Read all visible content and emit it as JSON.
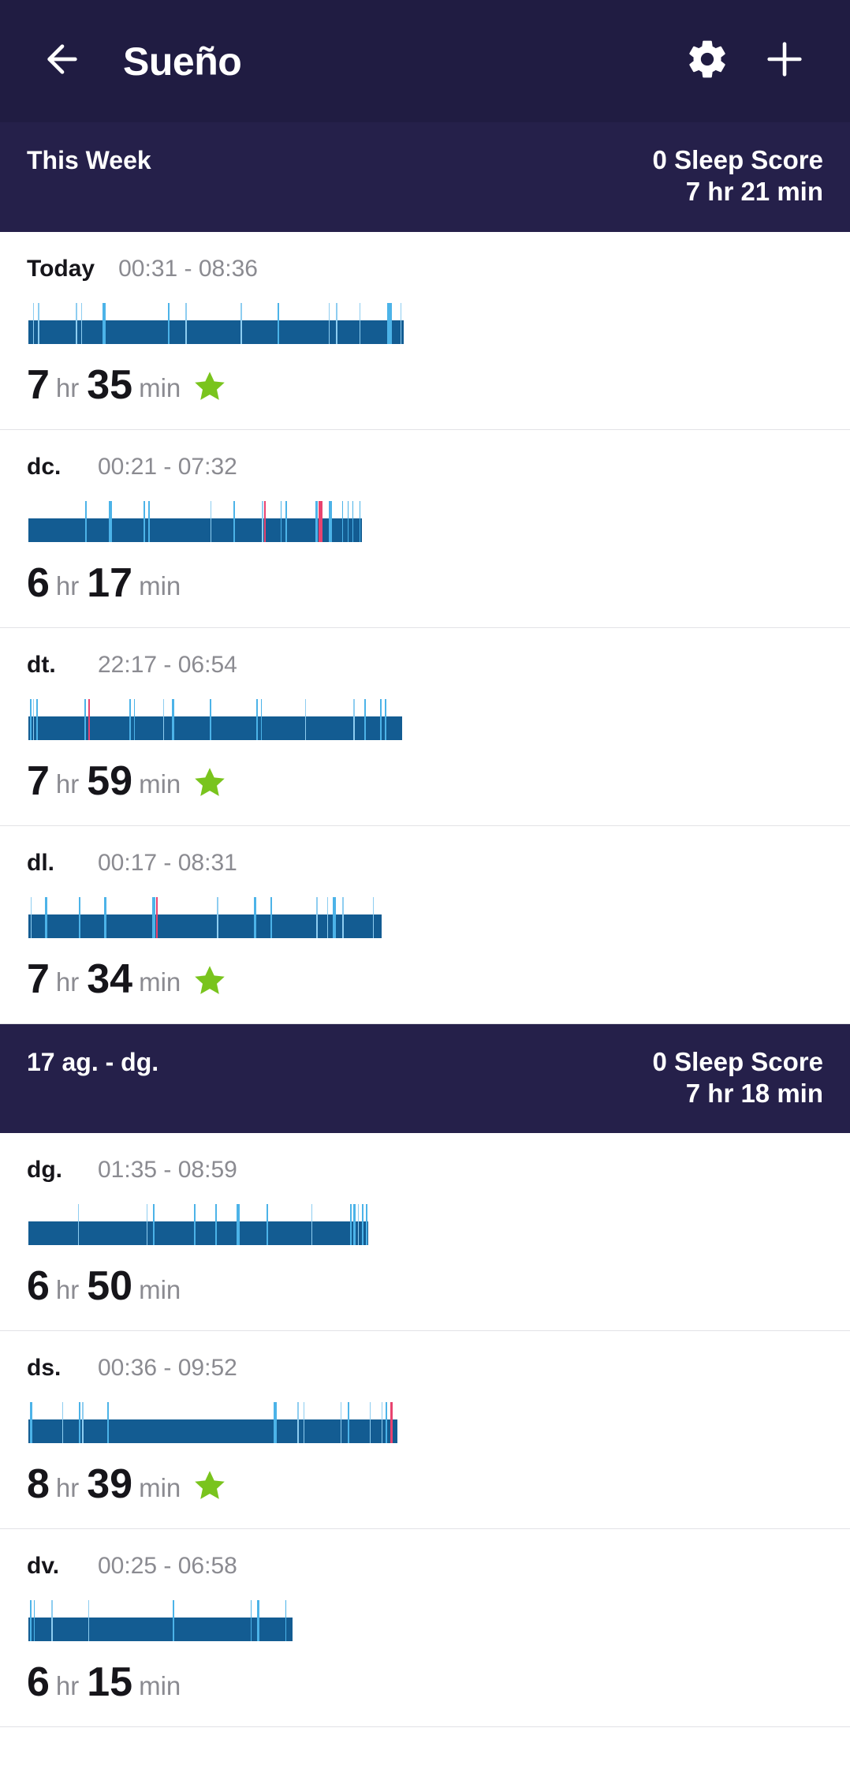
{
  "appbar": {
    "title": "Sueño",
    "back_icon": "arrow-left-icon",
    "settings_icon": "gear-icon",
    "add_icon": "plus-icon"
  },
  "colors": {
    "header_bg": "#201c42",
    "band_bg": "#25204a",
    "sleep_deep": "#135c92",
    "sleep_awake": "#4cb3e8",
    "sleep_awake_light": "#8ecdf0",
    "sleep_alert": "#e8436f",
    "star_green": "#79c41d",
    "page_bg": "#ffffff",
    "muted_text": "#8b8b91",
    "primary_text": "#16151a"
  },
  "sections": [
    {
      "label": "This Week",
      "score": "0 Sleep Score",
      "total": "7 hr 21 min",
      "entries": [
        {
          "day": "Today",
          "times": "00:31 - 08:36",
          "dur_hours": "7",
          "hr_label": "hr",
          "dur_minutes": "35",
          "min_label": "min",
          "starred": true,
          "bar_width_pct": 47.2,
          "ticks": [
            {
              "pos": 1.2,
              "w": 0.35,
              "c": "#8ecdf0"
            },
            {
              "pos": 2.6,
              "w": 0.3,
              "c": "#8ecdf0"
            },
            {
              "pos": 12.6,
              "w": 0.35,
              "c": "#8ecdf0"
            },
            {
              "pos": 14.0,
              "w": 0.3,
              "c": "#8ecdf0"
            },
            {
              "pos": 19.7,
              "w": 1.0,
              "c": "#4cb3e8"
            },
            {
              "pos": 37.2,
              "w": 0.5,
              "c": "#4cb3e8"
            },
            {
              "pos": 41.8,
              "w": 0.35,
              "c": "#8ecdf0"
            },
            {
              "pos": 56.6,
              "w": 0.35,
              "c": "#8ecdf0"
            },
            {
              "pos": 66.4,
              "w": 0.4,
              "c": "#4cb3e8"
            },
            {
              "pos": 80.0,
              "w": 0.35,
              "c": "#8ecdf0"
            },
            {
              "pos": 82.0,
              "w": 0.3,
              "c": "#8ecdf0"
            },
            {
              "pos": 88.2,
              "w": 0.35,
              "c": "#8ecdf0"
            },
            {
              "pos": 95.6,
              "w": 1.2,
              "c": "#4cb3e8"
            },
            {
              "pos": 99.2,
              "w": 0.3,
              "c": "#8ecdf0"
            }
          ]
        },
        {
          "day": "dc.",
          "times": "00:21 - 07:32",
          "dur_hours": "6",
          "hr_label": "hr",
          "dur_minutes": "17",
          "min_label": "min",
          "starred": false,
          "bar_width_pct": 42.0,
          "ticks": [
            {
              "pos": 17.0,
              "w": 0.4,
              "c": "#4cb3e8"
            },
            {
              "pos": 24.0,
              "w": 1.0,
              "c": "#4cb3e8"
            },
            {
              "pos": 34.5,
              "w": 0.4,
              "c": "#4cb3e8"
            },
            {
              "pos": 36.0,
              "w": 0.4,
              "c": "#4cb3e8"
            },
            {
              "pos": 54.5,
              "w": 0.3,
              "c": "#8ecdf0"
            },
            {
              "pos": 61.5,
              "w": 0.5,
              "c": "#4cb3e8"
            },
            {
              "pos": 70.0,
              "w": 0.4,
              "c": "#8ecdf0"
            },
            {
              "pos": 70.6,
              "w": 0.5,
              "c": "#e8436f"
            },
            {
              "pos": 75.5,
              "w": 0.4,
              "c": "#4cb3e8"
            },
            {
              "pos": 77.0,
              "w": 0.4,
              "c": "#4cb3e8"
            },
            {
              "pos": 86.0,
              "w": 0.6,
              "c": "#4cb3e8"
            },
            {
              "pos": 86.9,
              "w": 1.1,
              "c": "#e8436f"
            },
            {
              "pos": 90.0,
              "w": 0.9,
              "c": "#4cb3e8"
            },
            {
              "pos": 94.0,
              "w": 0.35,
              "c": "#4cb3e8"
            },
            {
              "pos": 95.6,
              "w": 0.35,
              "c": "#4cb3e8"
            },
            {
              "pos": 97.0,
              "w": 0.35,
              "c": "#4cb3e8"
            },
            {
              "pos": 99.2,
              "w": 0.35,
              "c": "#4cb3e8"
            }
          ]
        },
        {
          "day": "dt.",
          "times": "22:17 - 06:54",
          "dur_hours": "7",
          "hr_label": "hr",
          "dur_minutes": "59",
          "min_label": "min",
          "starred": true,
          "bar_width_pct": 47.0,
          "ticks": [
            {
              "pos": 0.4,
              "w": 0.35,
              "c": "#4cb3e8"
            },
            {
              "pos": 1.2,
              "w": 0.3,
              "c": "#8ecdf0"
            },
            {
              "pos": 2.1,
              "w": 0.35,
              "c": "#4cb3e8"
            },
            {
              "pos": 15.0,
              "w": 0.5,
              "c": "#4cb3e8"
            },
            {
              "pos": 16.0,
              "w": 0.55,
              "c": "#e8436f"
            },
            {
              "pos": 27.0,
              "w": 0.35,
              "c": "#4cb3e8"
            },
            {
              "pos": 28.2,
              "w": 0.35,
              "c": "#4cb3e8"
            },
            {
              "pos": 36.0,
              "w": 0.3,
              "c": "#8ecdf0"
            },
            {
              "pos": 38.5,
              "w": 0.45,
              "c": "#4cb3e8"
            },
            {
              "pos": 48.5,
              "w": 0.45,
              "c": "#4cb3e8"
            },
            {
              "pos": 61.0,
              "w": 0.35,
              "c": "#4cb3e8"
            },
            {
              "pos": 62.2,
              "w": 0.35,
              "c": "#4cb3e8"
            },
            {
              "pos": 74.0,
              "w": 0.3,
              "c": "#8ecdf0"
            },
            {
              "pos": 87.0,
              "w": 0.3,
              "c": "#8ecdf0"
            },
            {
              "pos": 90.0,
              "w": 0.35,
              "c": "#4cb3e8"
            },
            {
              "pos": 94.2,
              "w": 0.45,
              "c": "#4cb3e8"
            },
            {
              "pos": 95.4,
              "w": 0.35,
              "c": "#4cb3e8"
            }
          ]
        },
        {
          "day": "dl.",
          "times": "00:17 - 08:31",
          "dur_hours": "7",
          "hr_label": "hr",
          "dur_minutes": "34",
          "min_label": "min",
          "starred": true,
          "bar_width_pct": 44.4,
          "ticks": [
            {
              "pos": 0.6,
              "w": 0.3,
              "c": "#8ecdf0"
            },
            {
              "pos": 4.6,
              "w": 0.7,
              "c": "#4cb3e8"
            },
            {
              "pos": 14.2,
              "w": 0.5,
              "c": "#4cb3e8"
            },
            {
              "pos": 21.4,
              "w": 0.7,
              "c": "#4cb3e8"
            },
            {
              "pos": 35.0,
              "w": 0.9,
              "c": "#4cb3e8"
            },
            {
              "pos": 36.2,
              "w": 0.4,
              "c": "#e8436f"
            },
            {
              "pos": 53.5,
              "w": 0.35,
              "c": "#8ecdf0"
            },
            {
              "pos": 64.0,
              "w": 0.55,
              "c": "#4cb3e8"
            },
            {
              "pos": 68.6,
              "w": 0.55,
              "c": "#4cb3e8"
            },
            {
              "pos": 81.6,
              "w": 0.3,
              "c": "#8ecdf0"
            },
            {
              "pos": 84.6,
              "w": 0.35,
              "c": "#8ecdf0"
            },
            {
              "pos": 86.2,
              "w": 0.9,
              "c": "#4cb3e8"
            },
            {
              "pos": 89.0,
              "w": 0.35,
              "c": "#8ecdf0"
            },
            {
              "pos": 97.6,
              "w": 0.35,
              "c": "#8ecdf0"
            }
          ]
        }
      ]
    },
    {
      "label": "17 ag. - dg.",
      "score": "0 Sleep Score",
      "total": "7 hr 18 min",
      "entries": [
        {
          "day": "dg.",
          "times": "01:35 - 08:59",
          "dur_hours": "6",
          "hr_label": "hr",
          "dur_minutes": "50",
          "min_label": "min",
          "starred": false,
          "bar_width_pct": 42.8,
          "ticks": [
            {
              "pos": 14.6,
              "w": 0.3,
              "c": "#8ecdf0"
            },
            {
              "pos": 34.8,
              "w": 0.3,
              "c": "#8ecdf0"
            },
            {
              "pos": 36.6,
              "w": 0.4,
              "c": "#4cb3e8"
            },
            {
              "pos": 48.6,
              "w": 0.5,
              "c": "#4cb3e8"
            },
            {
              "pos": 55.0,
              "w": 0.5,
              "c": "#4cb3e8"
            },
            {
              "pos": 61.2,
              "w": 0.9,
              "c": "#4cb3e8"
            },
            {
              "pos": 70.0,
              "w": 0.5,
              "c": "#4cb3e8"
            },
            {
              "pos": 83.2,
              "w": 0.3,
              "c": "#8ecdf0"
            },
            {
              "pos": 94.6,
              "w": 0.4,
              "c": "#4cb3e8"
            },
            {
              "pos": 95.4,
              "w": 0.8,
              "c": "#4cb3e8"
            },
            {
              "pos": 96.8,
              "w": 0.35,
              "c": "#8ecdf0"
            },
            {
              "pos": 98.0,
              "w": 0.45,
              "c": "#4cb3e8"
            },
            {
              "pos": 99.2,
              "w": 0.45,
              "c": "#4cb3e8"
            }
          ]
        },
        {
          "day": "ds.",
          "times": "00:36 - 09:52",
          "dur_hours": "8",
          "hr_label": "hr",
          "dur_minutes": "39",
          "min_label": "min",
          "starred": true,
          "bar_width_pct": 46.4,
          "ticks": [
            {
              "pos": 0.4,
              "w": 0.6,
              "c": "#4cb3e8"
            },
            {
              "pos": 9.2,
              "w": 0.3,
              "c": "#8ecdf0"
            },
            {
              "pos": 13.6,
              "w": 0.45,
              "c": "#4cb3e8"
            },
            {
              "pos": 14.6,
              "w": 0.3,
              "c": "#8ecdf0"
            },
            {
              "pos": 21.4,
              "w": 0.45,
              "c": "#4cb3e8"
            },
            {
              "pos": 66.4,
              "w": 1.0,
              "c": "#4cb3e8"
            },
            {
              "pos": 73.0,
              "w": 0.3,
              "c": "#8ecdf0"
            },
            {
              "pos": 74.6,
              "w": 0.3,
              "c": "#8ecdf0"
            },
            {
              "pos": 84.6,
              "w": 0.35,
              "c": "#8ecdf0"
            },
            {
              "pos": 86.6,
              "w": 0.4,
              "c": "#4cb3e8"
            },
            {
              "pos": 92.6,
              "w": 0.3,
              "c": "#8ecdf0"
            },
            {
              "pos": 95.8,
              "w": 0.3,
              "c": "#8ecdf0"
            },
            {
              "pos": 96.8,
              "w": 0.4,
              "c": "#4cb3e8"
            },
            {
              "pos": 98.2,
              "w": 0.5,
              "c": "#e8436f"
            }
          ]
        },
        {
          "day": "dv.",
          "times": "00:25 - 06:58",
          "dur_hours": "6",
          "hr_label": "hr",
          "dur_minutes": "15",
          "min_label": "min",
          "starred": false,
          "bar_width_pct": 33.2,
          "ticks": [
            {
              "pos": 0.6,
              "w": 0.5,
              "c": "#4cb3e8"
            },
            {
              "pos": 2.0,
              "w": 0.45,
              "c": "#4cb3e8"
            },
            {
              "pos": 8.8,
              "w": 0.35,
              "c": "#8ecdf0"
            },
            {
              "pos": 22.6,
              "w": 0.35,
              "c": "#8ecdf0"
            },
            {
              "pos": 54.6,
              "w": 0.7,
              "c": "#4cb3e8"
            },
            {
              "pos": 84.2,
              "w": 0.35,
              "c": "#4cb3e8"
            },
            {
              "pos": 86.8,
              "w": 0.7,
              "c": "#4cb3e8"
            },
            {
              "pos": 97.4,
              "w": 0.4,
              "c": "#4cb3e8"
            }
          ]
        }
      ]
    }
  ]
}
